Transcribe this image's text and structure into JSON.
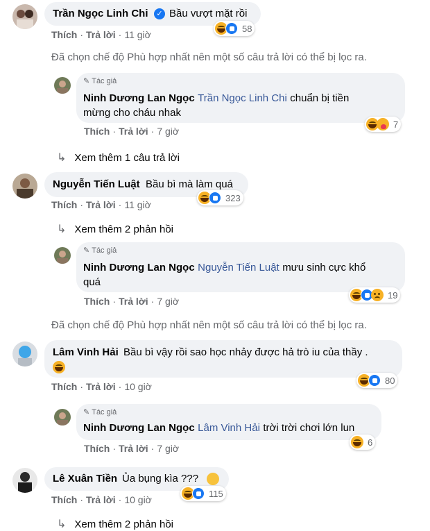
{
  "filter_note": "Đã chọn chế độ Phù hợp nhất nên một số câu trả lời có thể bị lọc ra.",
  "actions": {
    "like": "Thích",
    "reply": "Trả lời",
    "sep": "·"
  },
  "author_badge": "Tác giả",
  "comments": [
    {
      "author": "Trần Ngọc Linh Chi",
      "text": "Bầu vượt mặt rồi",
      "time": "11 giờ",
      "reaction_count": "58",
      "verified": true
    },
    {
      "author": "Ninh Dương Lan Ngọc",
      "mention": "Trần Ngọc Linh Chi",
      "text_line1": "chuẩn bị tiền",
      "text_line2": "mừng cho cháu nhak",
      "time": "7 giờ",
      "reaction_count": "7"
    },
    {
      "view_more": "Xem thêm 1 câu trả lời"
    },
    {
      "author": "Nguyễn Tiến Luật",
      "text": "Bầu bì mà làm quá",
      "time": "11 giờ",
      "reaction_count": "323"
    },
    {
      "view_more": "Xem thêm 2 phản hồi"
    },
    {
      "author": "Ninh Dương Lan Ngọc",
      "mention": "Nguyễn Tiến Luật",
      "text_line1": "mưu sinh cực khổ",
      "text_line2": "quá",
      "time": "7 giờ",
      "reaction_count": "19"
    },
    {
      "author": "Lâm Vinh Hải",
      "text": "Bầu bì vậy rồi sao học nhảy được hả trò iu của thầy .",
      "time": "10 giờ",
      "reaction_count": "80"
    },
    {
      "author": "Ninh Dương Lan Ngọc",
      "mention": "Lâm Vinh Hải",
      "text": "trời trời chơi lớn lun",
      "time": "7 giờ",
      "reaction_count": "6"
    },
    {
      "author": "Lê Xuân Tiền",
      "text": "Ủa bụng kìa ???",
      "time": "10 giờ",
      "reaction_count": "115"
    },
    {
      "view_more": "Xem thêm 2 phản hồi"
    }
  ]
}
